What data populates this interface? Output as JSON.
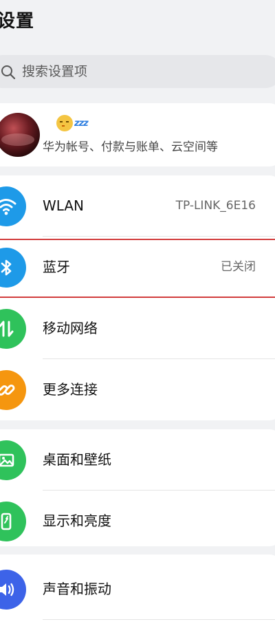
{
  "header": {
    "title": "设置"
  },
  "search": {
    "placeholder": "搜索设置项"
  },
  "account": {
    "status_emoji": "sleepy-face-zzz",
    "zzz": "zzz",
    "subtitle": "华为帐号、付款与账单、云空间等"
  },
  "network": {
    "wlan": {
      "label": "WLAN",
      "value": "TP-LINK_6E16",
      "icon": "wifi-icon",
      "color": "#1e9ae8"
    },
    "bluetooth": {
      "label": "蓝牙",
      "value": "已关闭",
      "icon": "bluetooth-icon",
      "color": "#1e9ae8"
    },
    "mobile": {
      "label": "移动网络",
      "icon": "mobile-data-icon",
      "color": "#2fc25b"
    },
    "more": {
      "label": "更多连接",
      "icon": "link-icon",
      "color": "#f5960f"
    }
  },
  "display_group": {
    "wallpaper": {
      "label": "桌面和壁纸",
      "icon": "image-icon",
      "color": "#2fc25b"
    },
    "display": {
      "label": "显示和亮度",
      "icon": "display-icon",
      "color": "#2fc25b"
    }
  },
  "sound_group": {
    "sound": {
      "label": "声音和振动",
      "icon": "speaker-icon",
      "color": "#3d63e8"
    }
  },
  "highlight_color": "#d23c3c"
}
